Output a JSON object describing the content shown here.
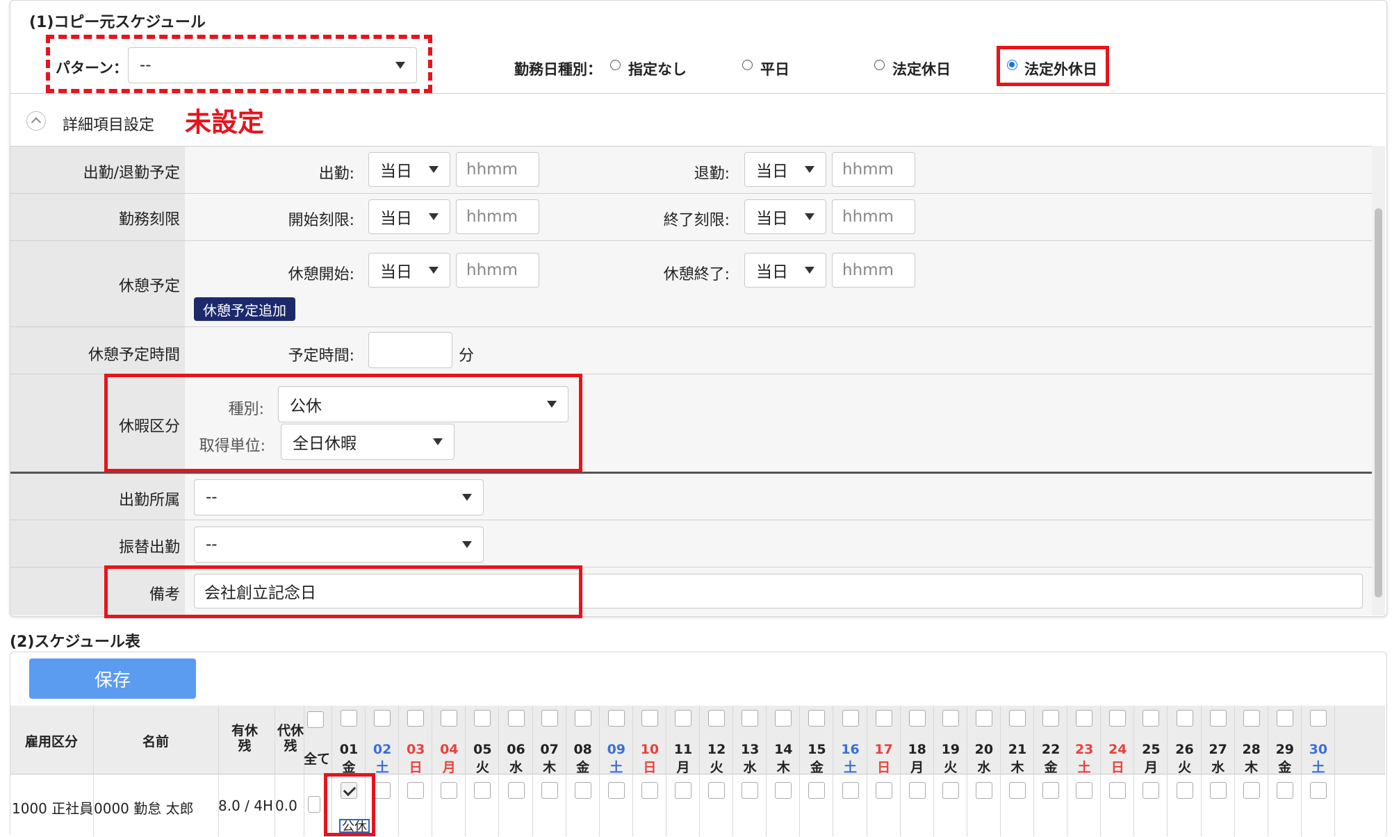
{
  "section1": {
    "title": "(1)コピー元スケジュール",
    "pattern_label": "パターン：",
    "pattern_value": "--",
    "workday_type_label": "勤務日種別：",
    "workday_options": [
      "指定なし",
      "平日",
      "法定休日",
      "法定外休日"
    ],
    "workday_selected": "法定外休日",
    "annotation_unset": "未設定",
    "detail_toggle_label": "詳細項目設定"
  },
  "form": {
    "row_attendance": {
      "label": "出勤/退勤予定",
      "start_label": "出勤:",
      "start_day": "当日",
      "start_placeholder": "hhmm",
      "end_label": "退勤:",
      "end_day": "当日",
      "end_placeholder": "hhmm"
    },
    "row_limit": {
      "label": "勤務刻限",
      "start_label": "開始刻限:",
      "start_day": "当日",
      "start_placeholder": "hhmm",
      "end_label": "終了刻限:",
      "end_day": "当日",
      "end_placeholder": "hhmm"
    },
    "row_break": {
      "label": "休憩予定",
      "start_label": "休憩開始:",
      "start_day": "当日",
      "start_placeholder": "hhmm",
      "end_label": "休憩終了:",
      "end_day": "当日",
      "end_placeholder": "hhmm",
      "add_button": "休憩予定追加"
    },
    "row_break_time": {
      "label": "休憩予定時間",
      "field_label": "予定時間:",
      "value": "",
      "unit": "分"
    },
    "row_leave": {
      "label": "休暇区分",
      "type_label": "種別:",
      "type_value": "公休",
      "unit_label": "取得単位:",
      "unit_value": "全日休暇"
    },
    "row_dept": {
      "label": "出勤所属",
      "value": "--"
    },
    "row_substitute": {
      "label": "振替出勤",
      "value": "--"
    },
    "row_note": {
      "label": "備考",
      "value": "会社創立記念日"
    }
  },
  "section2": {
    "title": "(2)スケジュール表",
    "save_button": "保存",
    "headers": {
      "employment": "雇用区分",
      "name": "名前",
      "paid_leave": "有休残",
      "comp_leave": "代休残",
      "all": "全て"
    },
    "days": [
      {
        "d": "01",
        "w": "金",
        "c": "#222"
      },
      {
        "d": "02",
        "w": "土",
        "c": "#3b6fd6"
      },
      {
        "d": "03",
        "w": "日",
        "c": "#e8413d"
      },
      {
        "d": "04",
        "w": "月",
        "c": "#e8413d"
      },
      {
        "d": "05",
        "w": "火",
        "c": "#222"
      },
      {
        "d": "06",
        "w": "水",
        "c": "#222"
      },
      {
        "d": "07",
        "w": "木",
        "c": "#222"
      },
      {
        "d": "08",
        "w": "金",
        "c": "#222"
      },
      {
        "d": "09",
        "w": "土",
        "c": "#3b6fd6"
      },
      {
        "d": "10",
        "w": "日",
        "c": "#e8413d"
      },
      {
        "d": "11",
        "w": "月",
        "c": "#222"
      },
      {
        "d": "12",
        "w": "火",
        "c": "#222"
      },
      {
        "d": "13",
        "w": "水",
        "c": "#222"
      },
      {
        "d": "14",
        "w": "木",
        "c": "#222"
      },
      {
        "d": "15",
        "w": "金",
        "c": "#222"
      },
      {
        "d": "16",
        "w": "土",
        "c": "#3b6fd6"
      },
      {
        "d": "17",
        "w": "日",
        "c": "#e8413d"
      },
      {
        "d": "18",
        "w": "月",
        "c": "#222"
      },
      {
        "d": "19",
        "w": "火",
        "c": "#222"
      },
      {
        "d": "20",
        "w": "水",
        "c": "#222"
      },
      {
        "d": "21",
        "w": "木",
        "c": "#222"
      },
      {
        "d": "22",
        "w": "金",
        "c": "#222"
      },
      {
        "d": "23",
        "w": "土",
        "c": "#e8413d"
      },
      {
        "d": "24",
        "w": "日",
        "c": "#e8413d"
      },
      {
        "d": "25",
        "w": "月",
        "c": "#222"
      },
      {
        "d": "26",
        "w": "火",
        "c": "#222"
      },
      {
        "d": "27",
        "w": "水",
        "c": "#222"
      },
      {
        "d": "28",
        "w": "木",
        "c": "#222"
      },
      {
        "d": "29",
        "w": "金",
        "c": "#222"
      },
      {
        "d": "30",
        "w": "土",
        "c": "#3b6fd6"
      }
    ],
    "row": {
      "employment": "1000 正社員",
      "name": "0000 勤怠 太郎",
      "paid_leave": "8.0 / 4H",
      "comp_leave": "0.0",
      "day01_badge": "公休"
    }
  },
  "colors": {
    "accent_red": "#e8131b",
    "save_button": "#5b9bf0",
    "add_button": "#1c2a6b",
    "weekday_blue": "#3b6fd6",
    "holiday_red": "#e8413d"
  }
}
